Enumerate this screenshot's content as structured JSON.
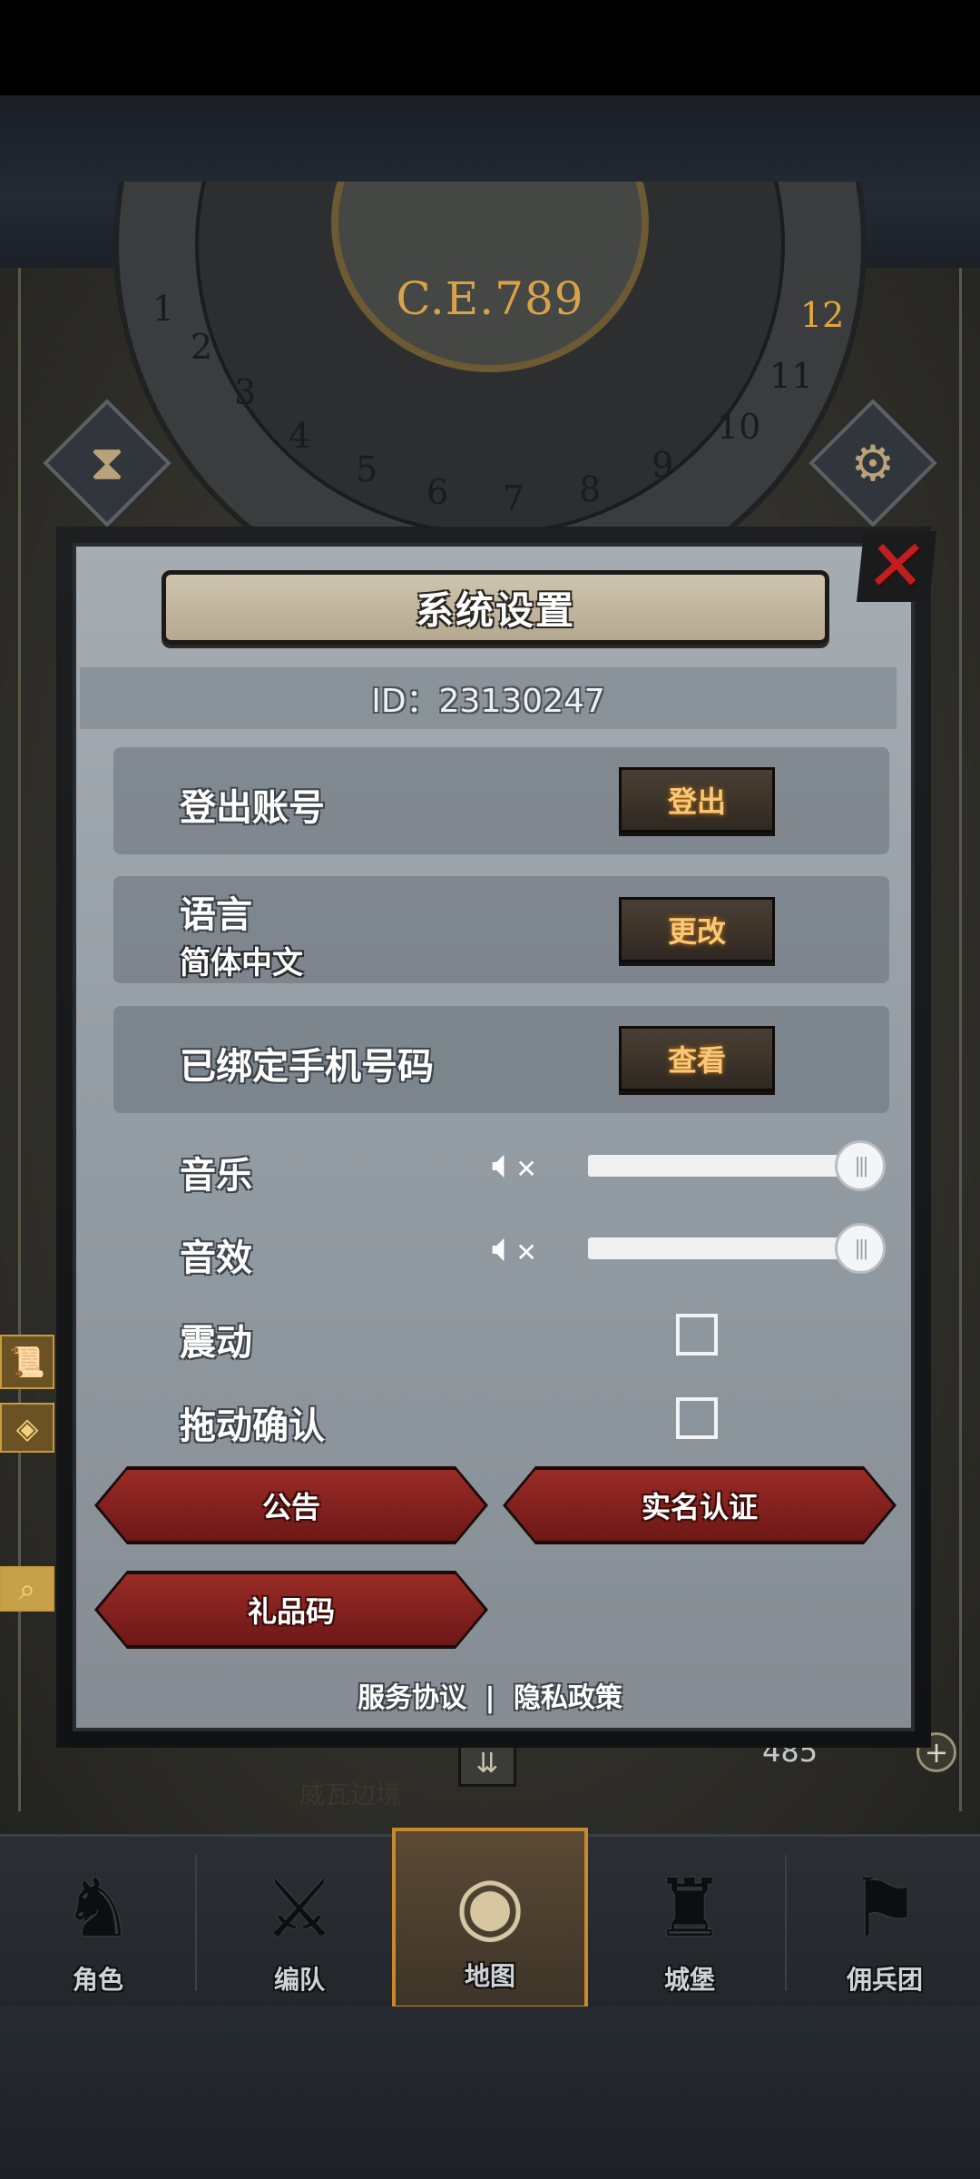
{
  "map": {
    "year": "C.E.789",
    "months": [
      "1",
      "2",
      "3",
      "4",
      "5",
      "6",
      "7",
      "8",
      "9",
      "10",
      "11",
      "12"
    ],
    "current_month": "12",
    "region_name": "威瓦边境",
    "resource_count": "485"
  },
  "dialog": {
    "title": "系统设置",
    "id_text": "ID：23130247",
    "rows": [
      {
        "label": "登出账号",
        "button": "登出"
      },
      {
        "label": "语言",
        "sublabel": "简体中文",
        "button": "更改"
      },
      {
        "label": "已绑定手机号码",
        "button": "查看"
      }
    ],
    "music": {
      "label": "音乐",
      "level": 1.0
    },
    "sound": {
      "label": "音效",
      "level": 1.0
    },
    "vibrate": {
      "label": "震动",
      "checked": false
    },
    "drag_confirm": {
      "label": "拖动确认",
      "checked": false
    },
    "buttons": {
      "announcement": "公告",
      "real_name": "实名认证",
      "gift_code": "礼品码"
    },
    "footer": {
      "terms": "服务协议",
      "separator": "|",
      "privacy": "隐私政策"
    }
  },
  "nav": {
    "items": [
      {
        "label": "角色",
        "icon": "knight-helmet-icon"
      },
      {
        "label": "编队",
        "icon": "armored-squad-icon"
      },
      {
        "label": "地图",
        "icon": "globe-map-icon",
        "active": true
      },
      {
        "label": "城堡",
        "icon": "castle-icon"
      },
      {
        "label": "佣兵团",
        "icon": "banner-flag-icon"
      }
    ]
  },
  "colors": {
    "accent_gold": "#d9a24a",
    "close_red": "#c11f1f",
    "button_red": "#8a2622",
    "active_border": "#c9882c"
  }
}
